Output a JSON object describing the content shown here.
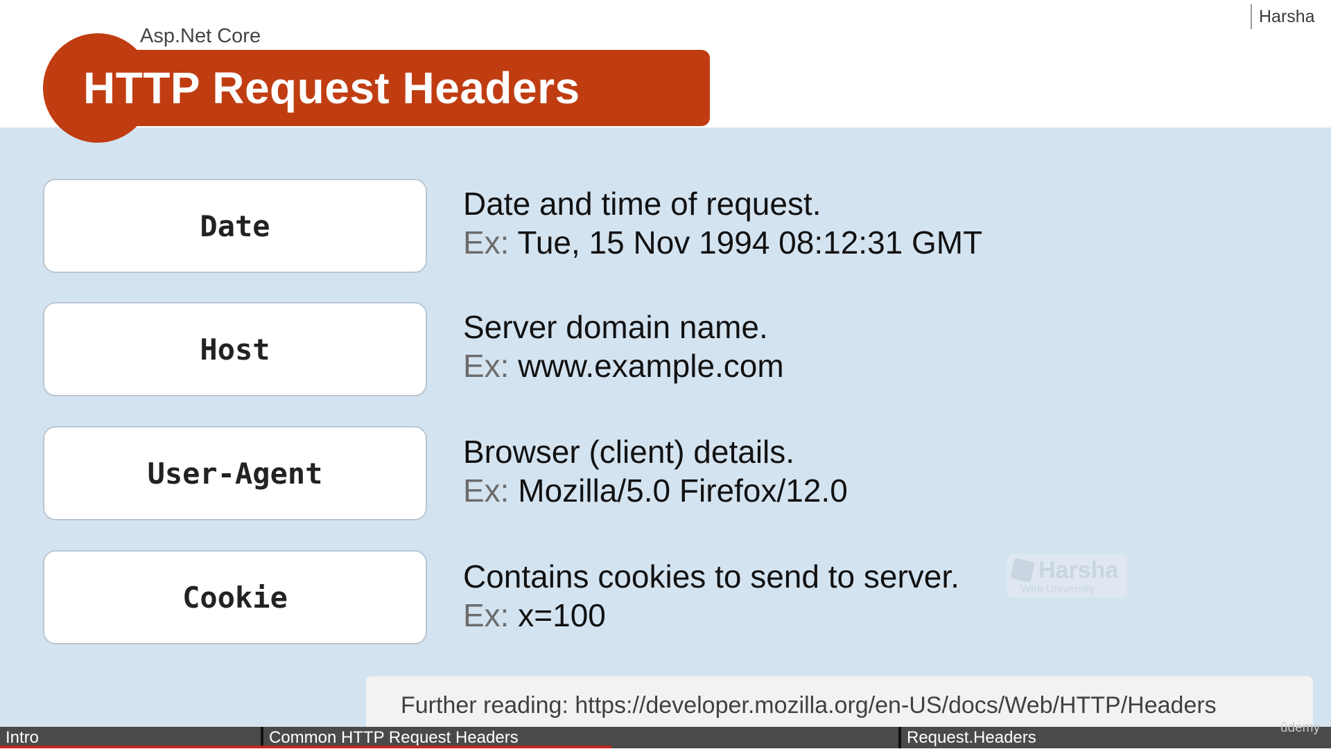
{
  "header": {
    "brand": "Harsha",
    "subtitle": "Asp.Net Core",
    "title": "HTTP Request Headers"
  },
  "headers": [
    {
      "name": "Date",
      "description": "Date and time of request.",
      "ex_label": "Ex:",
      "ex_value": "Tue, 15 Nov 1994 08:12:31 GMT"
    },
    {
      "name": "Host",
      "description": "Server domain name.",
      "ex_label": "Ex:",
      "ex_value": "www.example.com"
    },
    {
      "name": "User-Agent",
      "description": "Browser (client) details.",
      "ex_label": "Ex:",
      "ex_value": "Mozilla/5.0 Firefox/12.0"
    },
    {
      "name": "Cookie",
      "description": "Contains cookies to send to server.",
      "ex_label": "Ex:",
      "ex_value": "x=100"
    }
  ],
  "watermark": {
    "title": "Harsha",
    "subtitle": "Web University"
  },
  "further_reading": "Further reading: https://developer.mozilla.org/en-US/docs/Web/HTTP/Headers",
  "chapters": [
    "Intro",
    "Common HTTP Request Headers",
    "Request.Headers"
  ],
  "player": {
    "logo_text": "ūdemy",
    "progress": 0.46
  },
  "colors": {
    "accent": "#c03d12",
    "content_bg": "#d4e3f0",
    "progress": "#c0261e"
  }
}
